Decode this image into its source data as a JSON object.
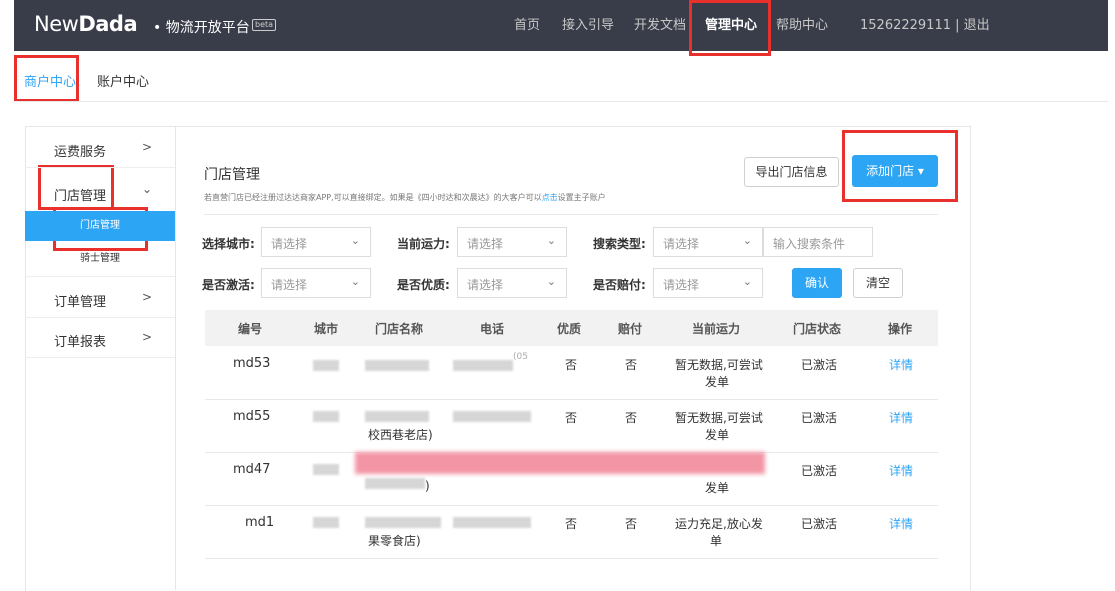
{
  "header": {
    "logo_main": "New",
    "logo_bold": "Dada",
    "logo_suffix": "• 物流开放平台",
    "beta": "beta",
    "nav": [
      {
        "label": "首页"
      },
      {
        "label": "接入引导"
      },
      {
        "label": "开发文档"
      },
      {
        "label": "管理中心",
        "active": true
      },
      {
        "label": "帮助中心"
      }
    ],
    "user": "15262229111 | 退出"
  },
  "subnav": [
    {
      "label": "商户中心",
      "active": true
    },
    {
      "label": "账户中心"
    }
  ],
  "sidebar": {
    "items": [
      {
        "label": "运费服务",
        "arrow": ">"
      },
      {
        "label": "门店管理",
        "arrow": "⌄",
        "expanded": true,
        "children": [
          {
            "label": "门店管理",
            "active": true
          },
          {
            "label": "骑士管理"
          }
        ]
      },
      {
        "label": "订单管理",
        "arrow": ">"
      },
      {
        "label": "订单报表",
        "arrow": ">"
      }
    ]
  },
  "main": {
    "title": "门店管理",
    "hint_before": "若直营门店已经注册过达达商家APP,可以直接绑定。如果是《四小时达和次晨达》的大客户可以",
    "hint_link": "点击",
    "hint_after": "设置主子账户",
    "export_button": "导出门店信息",
    "add_button": "添加门店 ▾"
  },
  "filters": {
    "city_label": "选择城市:",
    "capacity_label": "当前运力:",
    "search_type_label": "搜索类型:",
    "activated_label": "是否激活:",
    "premium_label": "是否优质:",
    "compensate_label": "是否赔付:",
    "select_placeholder": "请选择",
    "search_placeholder": "输入搜索条件",
    "confirm": "确认",
    "clear": "清空"
  },
  "table": {
    "columns": [
      "编号",
      "城市",
      "门店名称",
      "电话",
      "优质",
      "赔付",
      "当前运力",
      "门店状态",
      "操作"
    ],
    "rows": [
      {
        "id": "md53",
        "name_tail": "",
        "phone_tail": "(05",
        "premium": "否",
        "compensate": "否",
        "capacity_l1": "暂无数据,可尝试",
        "capacity_l2": "发单",
        "status": "已激活",
        "action": "详情"
      },
      {
        "id": "md55",
        "name_tail": "校西巷老店)",
        "phone_tail": "",
        "premium": "否",
        "compensate": "否",
        "capacity_l1": "暂无数据,可尝试",
        "capacity_l2": "发单",
        "status": "已激活",
        "action": "详情"
      },
      {
        "id": "md47",
        "name_tail": ")",
        "phone_tail": "",
        "premium": "",
        "compensate": "",
        "capacity_l1": "",
        "capacity_l2": "发单",
        "status": "已激活",
        "action": "详情"
      },
      {
        "id": "md1",
        "name_tail": "果零食店)",
        "phone_tail": "",
        "premium": "否",
        "compensate": "否",
        "capacity_l1": "运力充足,放心发",
        "capacity_l2": "单",
        "status": "已激活",
        "action": "详情"
      }
    ]
  },
  "colors": {
    "accent": "#2da5f5",
    "topbar": "#393d49",
    "annotation": "#e8302c"
  }
}
